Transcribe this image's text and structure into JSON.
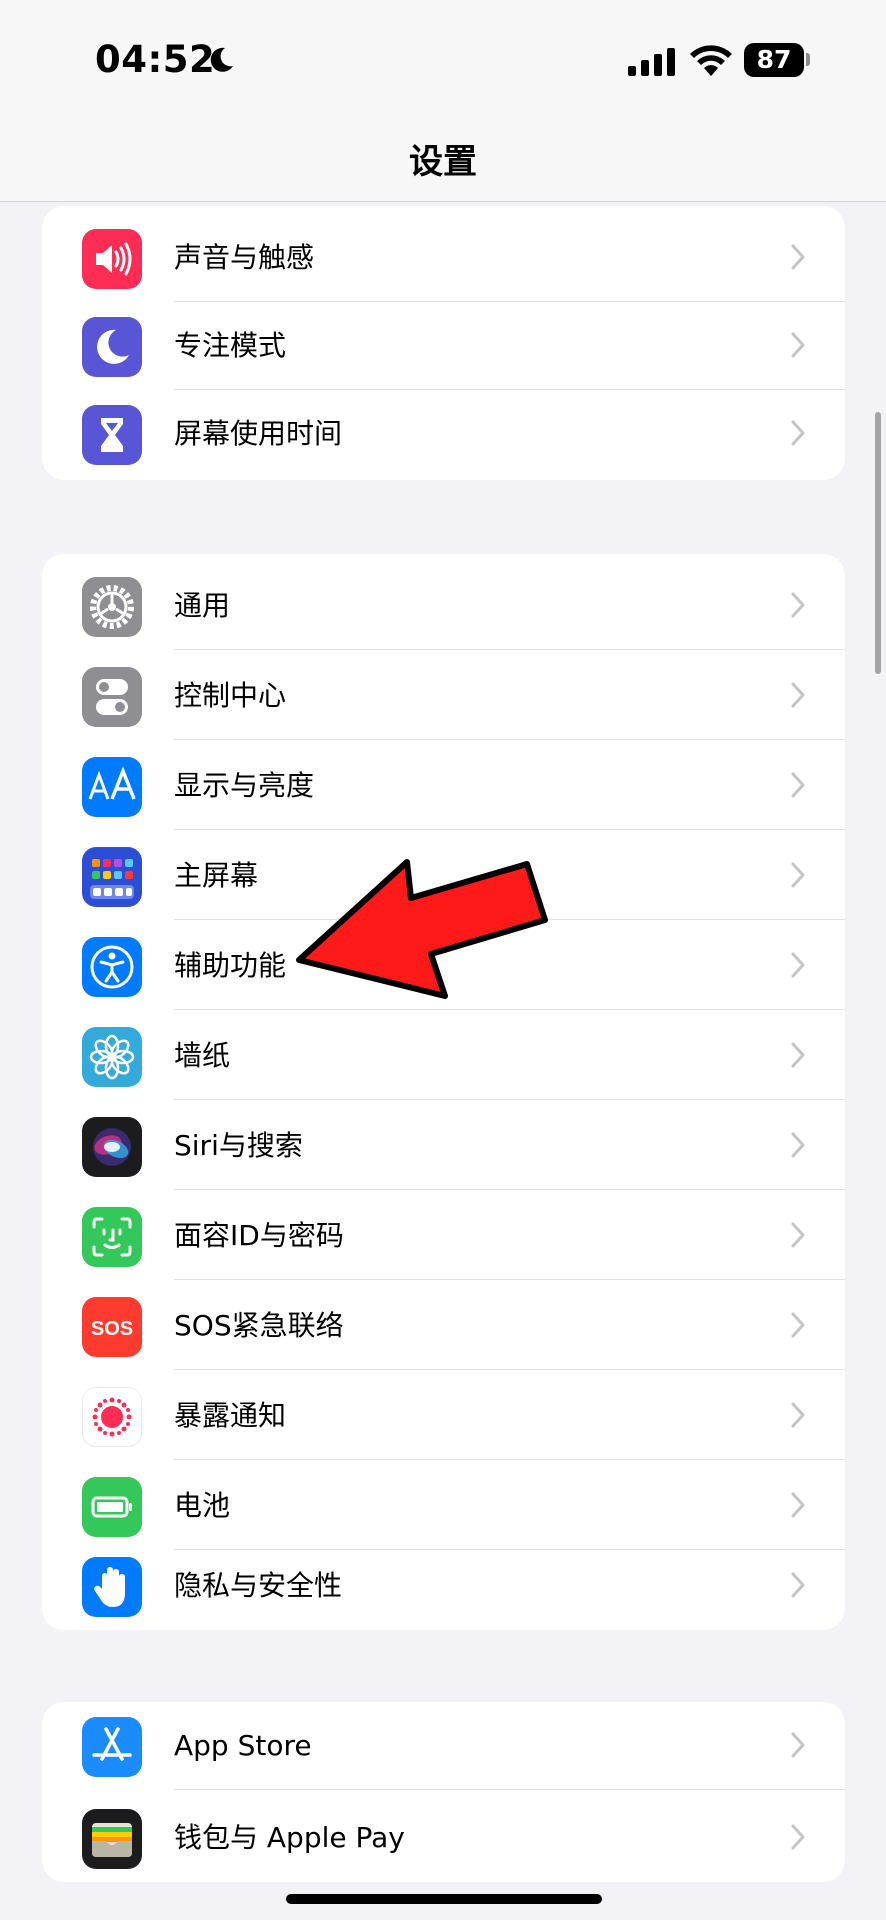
{
  "status_bar": {
    "time": "04:52",
    "battery": "87"
  },
  "nav": {
    "title": "设置"
  },
  "groups": [
    {
      "items": [
        {
          "label": "声音与触感",
          "icon": "speaker-icon",
          "color": "#ff2d55"
        },
        {
          "label": "专注模式",
          "icon": "moon-icon",
          "color": "#5856d6"
        },
        {
          "label": "屏幕使用时间",
          "icon": "hourglass-icon",
          "color": "#5856d6"
        }
      ]
    },
    {
      "items": [
        {
          "label": "通用",
          "icon": "gear-icon",
          "color": "#8e8e93"
        },
        {
          "label": "控制中心",
          "icon": "toggles-icon",
          "color": "#8e8e93"
        },
        {
          "label": "显示与亮度",
          "icon": "text-size-icon",
          "color": "#007aff"
        },
        {
          "label": "主屏幕",
          "icon": "home-screen-icon",
          "color": "#2c4dd6"
        },
        {
          "label": "辅助功能",
          "icon": "accessibility-icon",
          "color": "#007aff"
        },
        {
          "label": "墙纸",
          "icon": "flower-icon",
          "color": "#34aadc"
        },
        {
          "label": "Siri与搜索",
          "icon": "siri-icon",
          "color": "#1c1c1e"
        },
        {
          "label": "面容ID与密码",
          "icon": "face-id-icon",
          "color": "#34c759"
        },
        {
          "label": "SOS紧急联络",
          "icon": "sos-icon",
          "color": "#ff3b30",
          "icon_text": "SOS"
        },
        {
          "label": "暴露通知",
          "icon": "exposure-icon",
          "color": "#ff2d55"
        },
        {
          "label": "电池",
          "icon": "battery-icon",
          "color": "#34c759"
        },
        {
          "label": "隐私与安全性",
          "icon": "hand-icon",
          "color": "#007aff"
        }
      ]
    },
    {
      "items": [
        {
          "label": "App Store",
          "icon": "app-store-icon",
          "color": "#1a8cff"
        },
        {
          "label": "钱包与 Apple Pay",
          "icon": "wallet-icon",
          "color": "#1c1c1e"
        }
      ]
    }
  ],
  "annotation": {
    "arrow_color": "#ff1a1a"
  }
}
